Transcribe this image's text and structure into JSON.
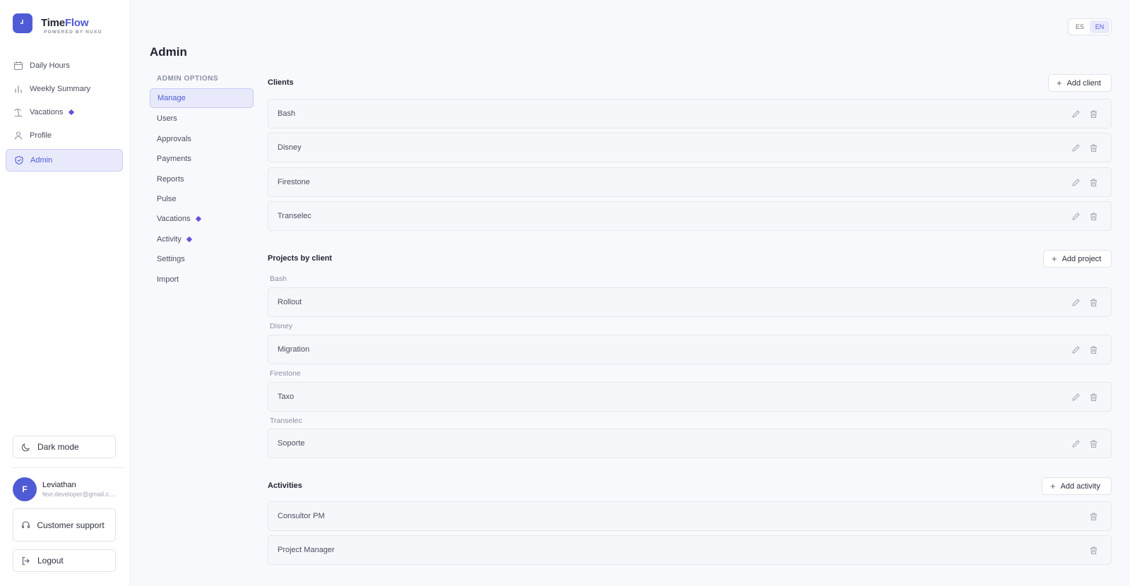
{
  "app": {
    "name_part1": "Time",
    "name_part2": "Flow",
    "powered_by": "POWERED BY NUXO"
  },
  "nav": [
    {
      "label": "Daily Hours",
      "icon": "calendar-icon"
    },
    {
      "label": "Weekly Summary",
      "icon": "bar-chart-icon"
    },
    {
      "label": "Vacations",
      "icon": "vacation-icon",
      "badge": true
    },
    {
      "label": "Profile",
      "icon": "user-icon"
    },
    {
      "label": "Admin",
      "icon": "shield-icon",
      "active": true
    }
  ],
  "sidebar_bottom": {
    "dark_mode": "Dark mode",
    "user": {
      "initial": "F",
      "name": "Leviathan",
      "email": "fevr.developer@gmail.com"
    },
    "support": "Customer support",
    "logout": "Logout"
  },
  "lang": {
    "es": "ES",
    "en": "EN",
    "active": "EN"
  },
  "page": {
    "title": "Admin"
  },
  "admin_options": {
    "header": "ADMIN OPTIONS",
    "items": [
      "Manage",
      "Users",
      "Approvals",
      "Payments",
      "Reports",
      "Pulse",
      "Vacations",
      "Activity",
      "Settings",
      "Import"
    ],
    "active": "Manage"
  },
  "clients": {
    "title": "Clients",
    "add_label": "Add client",
    "items": [
      "Bash",
      "Disney",
      "Firestone",
      "Transelec"
    ]
  },
  "projects": {
    "title": "Projects by client",
    "add_label": "Add project",
    "groups": [
      {
        "client": "Bash",
        "projects": [
          "Rollout"
        ]
      },
      {
        "client": "Disney",
        "projects": [
          "Migration"
        ]
      },
      {
        "client": "Firestone",
        "projects": [
          "Taxo"
        ]
      },
      {
        "client": "Transelec",
        "projects": [
          "Soporte"
        ]
      }
    ]
  },
  "activities": {
    "title": "Activities",
    "add_label": "Add activity",
    "items": [
      "Consultor PM",
      "Project Manager"
    ]
  },
  "colors": {
    "accent": "#4f5bd5",
    "badge": "#6d4fe0",
    "background": "#f8f9fc"
  }
}
